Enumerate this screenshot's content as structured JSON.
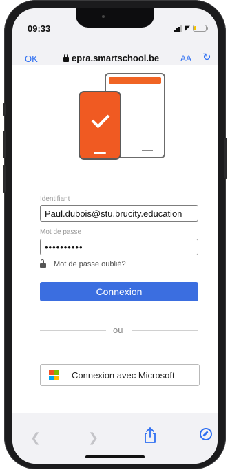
{
  "status": {
    "time": "09:33"
  },
  "browser": {
    "ok_label": "OK",
    "url": "epra.smartschool.be",
    "reader_label": "AA",
    "reload_icon": "reload-icon"
  },
  "login": {
    "username_label": "Identifiant",
    "username_value": "Paul.dubois@stu.brucity.education",
    "password_label": "Mot de passe",
    "password_value": "••••••••••",
    "forgot_label": "Mot de passe oublié?",
    "submit_label": "Connexion",
    "divider_text": "ou",
    "microsoft_label": "Connexion avec Microsoft"
  },
  "colors": {
    "accent": "#3b6ee0",
    "illustration_orange": "#f05a22",
    "browser_blue": "#2e6ff2"
  },
  "toolbar": {
    "back_icon": "chevron-left-icon",
    "forward_icon": "chevron-right-icon",
    "share_icon": "share-icon",
    "compass_icon": "compass-icon"
  }
}
